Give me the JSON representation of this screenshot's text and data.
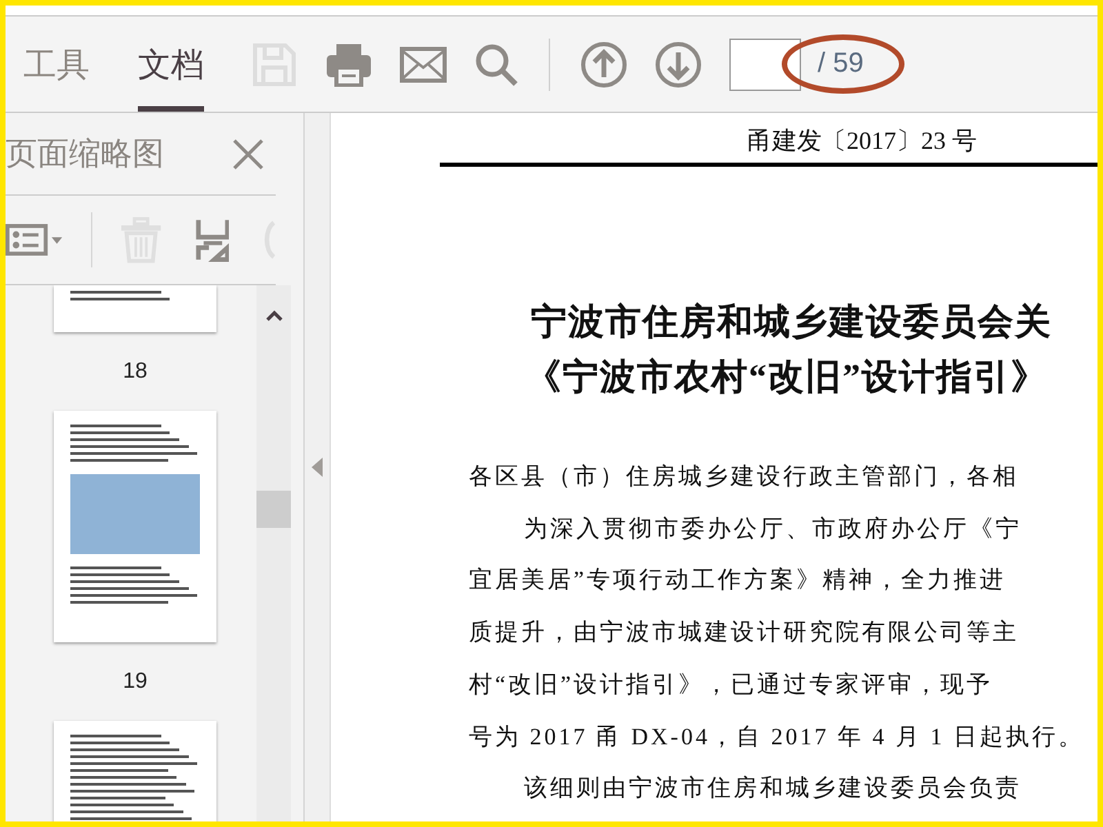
{
  "toolbar": {
    "tabs": [
      {
        "label": "工具",
        "selected": false
      },
      {
        "label": "文档",
        "selected": true
      }
    ],
    "tools": [
      {
        "kind": "save",
        "disabled": true
      },
      {
        "kind": "print",
        "disabled": false
      },
      {
        "kind": "mail",
        "disabled": false
      },
      {
        "kind": "search",
        "disabled": false
      },
      {
        "kind": "divider"
      },
      {
        "kind": "up",
        "disabled": false
      },
      {
        "kind": "down",
        "disabled": false
      }
    ],
    "page_total": "/ 59"
  },
  "thumbnail_panel": {
    "title": "页面缩略图",
    "tools": [
      {
        "kind": "options",
        "disabled": false
      },
      {
        "kind": "divider"
      },
      {
        "kind": "trash",
        "disabled": true
      },
      {
        "kind": "extract",
        "disabled": false
      },
      {
        "kind": "partial",
        "disabled": true
      }
    ],
    "thumbnails": [
      {
        "kind": "text-end",
        "label": "18"
      },
      {
        "kind": "text-photo",
        "label": "19"
      },
      {
        "kind": "text"
      }
    ]
  },
  "document": {
    "doc_number": "甬建发〔2017〕23 号",
    "title_lines": [
      "宁波市住房和城乡建设委员会关",
      "《宁波市农村“改旧”设计指引》"
    ],
    "paragraphs": [
      {
        "kind": "salutation",
        "lines": [
          "各区县（市）住房城乡建设行政主管部门，各相"
        ]
      },
      {
        "kind": "body",
        "lines": [
          "为深入贯彻市委办公厅、市政府办公厅《宁",
          "宜居美居”专项行动工作方案》精神，全力推进",
          "质提升，由宁波市城建设计研究院有限公司等主",
          "村“改旧”设计指引》，已通过专家评审，现予",
          "号为 2017 甬 DX-04，自 2017 年 4 月 1 日起执行。"
        ]
      },
      {
        "kind": "body",
        "lines": [
          "该细则由宁波市住房和城乡建设委员会负责"
        ]
      }
    ]
  }
}
